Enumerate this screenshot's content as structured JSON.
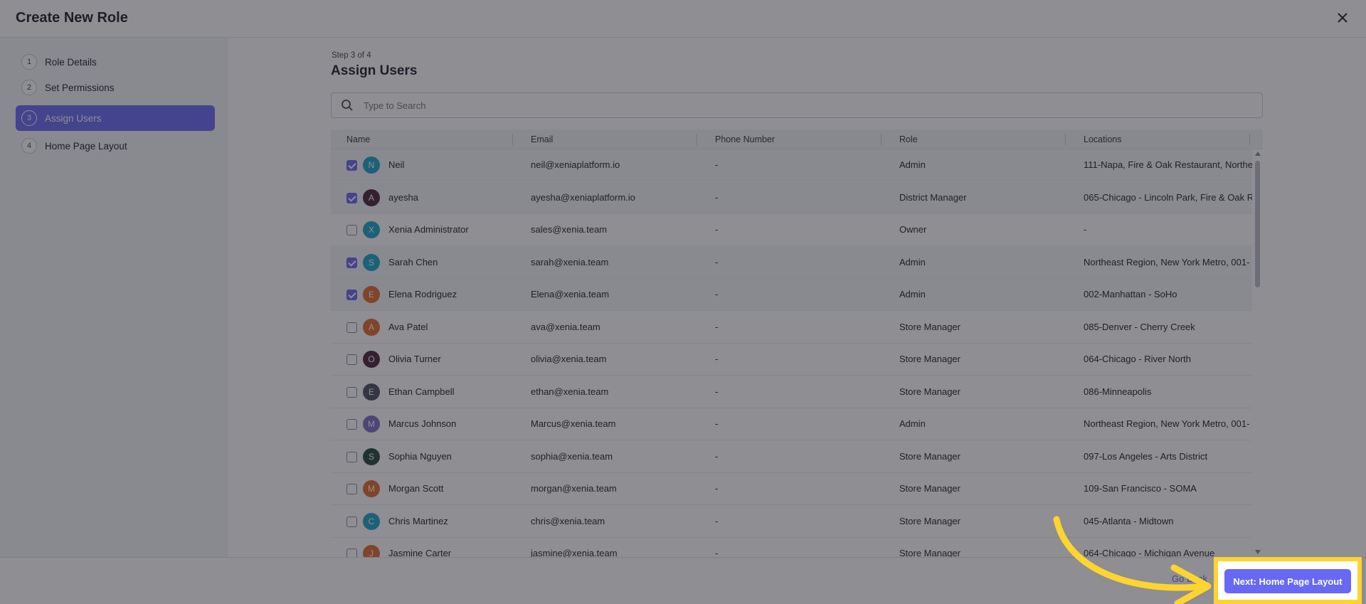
{
  "header": {
    "title": "Create New Role"
  },
  "sidebar": {
    "steps": [
      {
        "num": "1",
        "label": "Role Details"
      },
      {
        "num": "2",
        "label": "Set Permissions"
      },
      {
        "num": "3",
        "label": "Assign Users"
      },
      {
        "num": "4",
        "label": "Home Page Layout"
      }
    ],
    "active_step": 3
  },
  "main": {
    "step_counter": "Step 3 of 4",
    "title": "Assign Users",
    "search_placeholder": "Type to Search"
  },
  "table": {
    "columns": [
      "Name",
      "Email",
      "Phone Number",
      "Role",
      "Locations"
    ],
    "rows": [
      {
        "selected": true,
        "initial": "N",
        "avatar_color": "#1ba4c9",
        "name": "Neil",
        "email": "neil@xeniaplatform.io",
        "phone": "-",
        "role": "Admin",
        "locations": "111-Napa, Fire & Oak Restaurant, Northea"
      },
      {
        "selected": true,
        "initial": "A",
        "avatar_color": "#4d2338",
        "name": "ayesha",
        "email": "ayesha@xeniaplatform.io",
        "phone": "-",
        "role": "District Manager",
        "locations": "065-Chicago - Lincoln Park, Fire & Oak Re"
      },
      {
        "selected": false,
        "initial": "X",
        "avatar_color": "#1ba4c9",
        "name": "Xenia Administrator",
        "email": "sales@xenia.team",
        "phone": "-",
        "role": "Owner",
        "locations": "-"
      },
      {
        "selected": true,
        "initial": "S",
        "avatar_color": "#1ba4c9",
        "name": "Sarah Chen",
        "email": "sarah@xenia.team",
        "phone": "-",
        "role": "Admin",
        "locations": "Northeast Region, New York Metro, 001-"
      },
      {
        "selected": true,
        "initial": "E",
        "avatar_color": "#e26a2c",
        "name": "Elena Rodriguez",
        "email": "Elena@xenia.team",
        "phone": "-",
        "role": "Admin",
        "locations": "002-Manhattan - SoHo"
      },
      {
        "selected": false,
        "initial": "A",
        "avatar_color": "#e26a2c",
        "name": "Ava Patel",
        "email": "ava@xenia.team",
        "phone": "-",
        "role": "Store Manager",
        "locations": "085-Denver - Cherry Creek"
      },
      {
        "selected": false,
        "initial": "O",
        "avatar_color": "#4d2338",
        "name": "Olivia Turner",
        "email": "olivia@xenia.team",
        "phone": "-",
        "role": "Store Manager",
        "locations": "064-Chicago - River North"
      },
      {
        "selected": false,
        "initial": "E",
        "avatar_color": "#4a4f5a",
        "name": "Ethan Campbell",
        "email": "ethan@xenia.team",
        "phone": "-",
        "role": "Store Manager",
        "locations": "086-Minneapolis"
      },
      {
        "selected": false,
        "initial": "M",
        "avatar_color": "#7a6cc4",
        "name": "Marcus Johnson",
        "email": "Marcus@xenia.team",
        "phone": "-",
        "role": "Admin",
        "locations": "Northeast Region, New York Metro, 001-"
      },
      {
        "selected": false,
        "initial": "S",
        "avatar_color": "#1f4a3a",
        "name": "Sophia Nguyen",
        "email": "sophia@xenia.team",
        "phone": "-",
        "role": "Store Manager",
        "locations": "097-Los Angeles - Arts District"
      },
      {
        "selected": false,
        "initial": "M",
        "avatar_color": "#e26a2c",
        "name": "Morgan Scott",
        "email": "morgan@xenia.team",
        "phone": "-",
        "role": "Store Manager",
        "locations": "109-San Francisco - SOMA"
      },
      {
        "selected": false,
        "initial": "C",
        "avatar_color": "#1ba4c9",
        "name": "Chris Martinez",
        "email": "chris@xenia.team",
        "phone": "-",
        "role": "Store Manager",
        "locations": "045-Atlanta - Midtown"
      },
      {
        "selected": false,
        "initial": "J",
        "avatar_color": "#e26a2c",
        "name": "Jasmine Carter",
        "email": "jasmine@xenia.team",
        "phone": "-",
        "role": "Store Manager",
        "locations": "064-Chicago - Michigan Avenue"
      }
    ]
  },
  "footer": {
    "go_back_label": "Go Back",
    "next_label": "Next: Home Page Layout"
  },
  "colors": {
    "accent": "#6868f4",
    "highlight": "#fdd430"
  }
}
